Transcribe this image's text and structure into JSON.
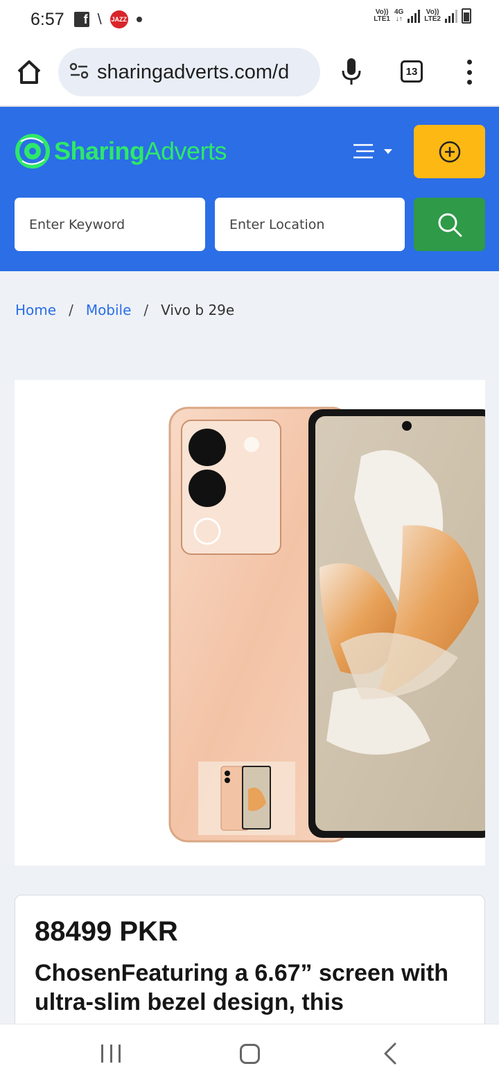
{
  "status_bar": {
    "time": "6:57",
    "carrier_badge": "JAZZ",
    "sim1": {
      "network": "Vo))",
      "type": "LTE1"
    },
    "data": {
      "type": "4G",
      "arrows": "↓↑"
    },
    "sim2": {
      "network": "Vo))",
      "type": "LTE2"
    }
  },
  "browser": {
    "url": "sharingadverts.com/d",
    "tab_count": "13"
  },
  "site_header": {
    "logo_part1": "Sharing",
    "logo_part2": "Adverts",
    "keyword_placeholder": "Enter Keyword",
    "location_placeholder": "Enter Location",
    "brand_color": "#2b6ee6",
    "post_button_color": "#fdb813",
    "search_button_color": "#2f9a47"
  },
  "breadcrumb": {
    "home": "Home",
    "separator": "/",
    "category": "Mobile",
    "current": "Vivo b 29e"
  },
  "product": {
    "price": "88499 PKR",
    "description": "ChosenFeaturing a 6.67” screen with ultra-slim bezel design, this"
  },
  "icons": [
    "home-icon",
    "site-settings-icon",
    "microphone-icon",
    "tabs-icon",
    "more-vert-icon",
    "menu-icon",
    "plus-circle-icon",
    "search-icon",
    "recent-apps-icon",
    "home-button-icon",
    "back-icon"
  ]
}
